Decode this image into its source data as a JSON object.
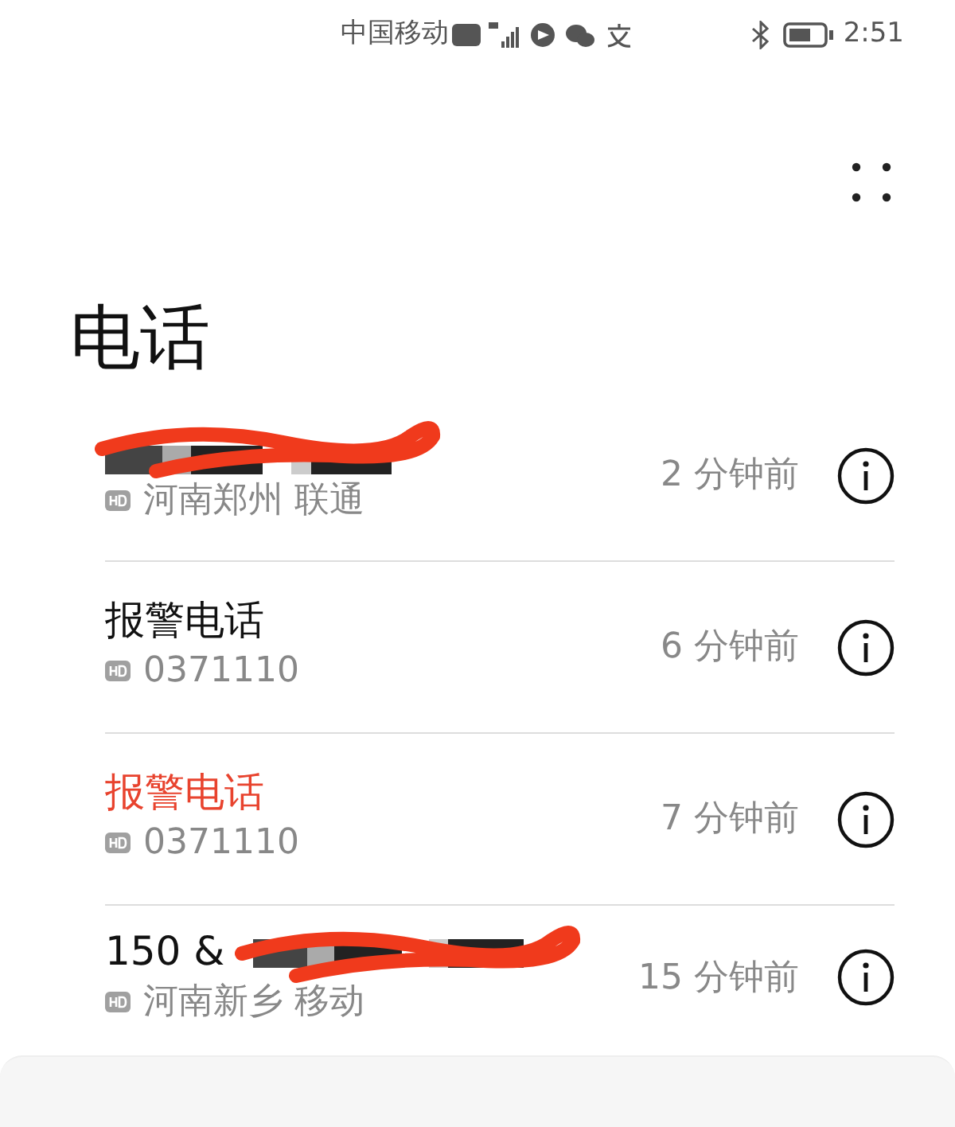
{
  "status_bar": {
    "carrier": "中国移动",
    "time": "2:51"
  },
  "title": "电话",
  "calls": [
    {
      "redacted": true,
      "location": "河南郑州 联通",
      "time_ago": "2 分钟前",
      "missed": false
    },
    {
      "name": "报警电话",
      "redacted": false,
      "location": "0371110",
      "time_ago": "6 分钟前",
      "missed": false
    },
    {
      "name": "报警电话",
      "redacted": false,
      "location": "0371110",
      "time_ago": "7 分钟前",
      "missed": true
    },
    {
      "name": "150 &",
      "redacted": true,
      "location": "河南新乡 移动",
      "time_ago": "15 分钟前",
      "missed": false
    }
  ]
}
